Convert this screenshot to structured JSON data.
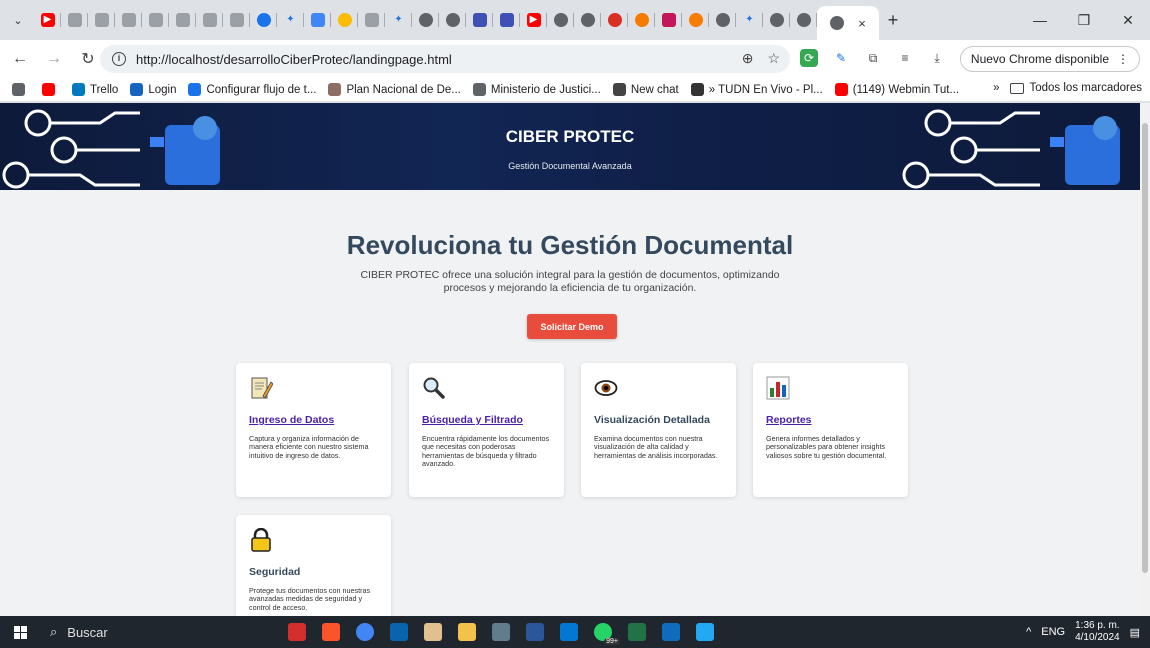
{
  "browser": {
    "tab_close": "×",
    "new_tab": "+",
    "url": "http://localhost/desarrolloCiberProtec/landingpage.html",
    "update_chip": "Nuevo Chrome disponible",
    "bookmarks": [
      {
        "label": "",
        "color": "#5f6368"
      },
      {
        "label": "",
        "color": "#ff0000"
      },
      {
        "label": "Trello",
        "color": "#0079bf"
      },
      {
        "label": "Login",
        "color": "#1565c0"
      },
      {
        "label": "Configurar flujo de t...",
        "color": "#1a73e8"
      },
      {
        "label": "Plan Nacional de De...",
        "color": "#8d6e63"
      },
      {
        "label": "Ministerio de Justici...",
        "color": "#5f6368"
      },
      {
        "label": "New chat",
        "color": "#444444"
      },
      {
        "label": "» TUDN En Vivo - Pl...",
        "color": "#333333"
      },
      {
        "label": "(1149) Webmin Tut...",
        "color": "#ff0000"
      }
    ],
    "bookmarks_more": "»",
    "all_bookmarks": "Todos los marcadores"
  },
  "page": {
    "site_title": "CIBER PROTEC",
    "site_subtitle": "Gestión Documental Avanzada",
    "hero_heading": "Revoluciona tu Gestión Documental",
    "hero_text": "CIBER PROTEC ofrece una solución integral para la gestión de documentos, optimizando procesos y mejorando la eficiencia de tu organización.",
    "demo_button": "Solicitar Demo",
    "features": [
      {
        "icon": "memo-icon",
        "title": "Ingreso de Datos",
        "link": true,
        "desc": "Captura y organiza información de manera eficiente con nuestro sistema intuitivo de ingreso de datos."
      },
      {
        "icon": "magnifier-icon",
        "title": "Búsqueda y Filtrado",
        "link": true,
        "desc": "Encuentra rápidamente los documentos que necesitas con poderosas herramientas de búsqueda y filtrado avanzado."
      },
      {
        "icon": "eye-icon",
        "title": "Visualización Detallada",
        "link": false,
        "desc": "Examina documentos con nuestra visualización de alta calidad y herramientas de análisis incorporadas."
      },
      {
        "icon": "bar-chart-icon",
        "title": "Reportes",
        "link": true,
        "desc": "Genera informes detallados y personalizables para obtener insights valiosos sobre tu gestión documental."
      },
      {
        "icon": "lock-icon",
        "title": "Seguridad",
        "link": false,
        "desc": "Protege tus documentos con nuestras avanzadas medidas de seguridad y control de acceso."
      }
    ]
  },
  "taskbar": {
    "search_placeholder": "Buscar",
    "language": "ENG",
    "time": "1:36 p. m.",
    "date": "4/10/2024",
    "whatsapp_badge": "99+"
  },
  "colors": {
    "accent": "#e74c3c",
    "heading": "#34495e",
    "banner": "#0f1f48",
    "link": "#4a1fa8"
  }
}
